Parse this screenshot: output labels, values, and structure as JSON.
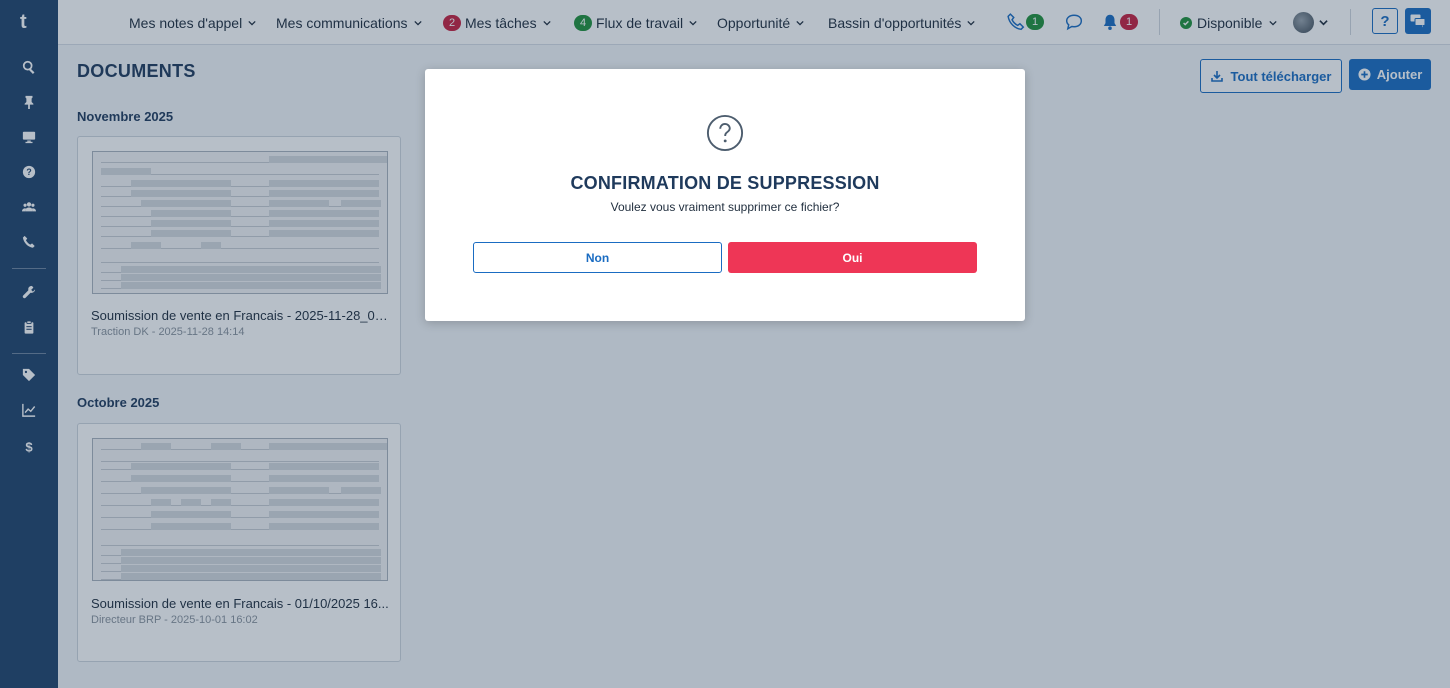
{
  "app": {
    "logo_text": "t"
  },
  "sidebar": {
    "items": [
      {
        "icon": "search-icon"
      },
      {
        "icon": "pin-icon"
      },
      {
        "icon": "monitor-icon"
      },
      {
        "icon": "help-circle-icon"
      },
      {
        "icon": "users-icon"
      },
      {
        "icon": "phone-icon"
      },
      {
        "icon": "wrench-icon"
      },
      {
        "icon": "clipboard-icon"
      },
      {
        "icon": "tag-icon"
      },
      {
        "icon": "chart-line-icon"
      },
      {
        "icon": "dollar-icon"
      }
    ]
  },
  "topbar": {
    "nav": [
      {
        "label": "Mes notes d'appel",
        "badge": null
      },
      {
        "label": "Mes communications",
        "badge": null
      },
      {
        "label": "Mes tâches",
        "badge": "2",
        "badge_color": "#c8203f"
      },
      {
        "label": "Flux de travail",
        "badge": "4",
        "badge_color": "#20913a"
      },
      {
        "label": "Opportunité",
        "badge": null
      },
      {
        "label": "Bassin d'opportunités",
        "badge": null
      }
    ],
    "phone_count": "1",
    "notification_count": "1",
    "status_label": "Disponible",
    "help_label": "?"
  },
  "main": {
    "title": "DOCUMENTS",
    "download_all_label": "Tout télécharger",
    "add_label": "Ajouter",
    "sections": [
      {
        "title": "Novembre 2025",
        "documents": [
          {
            "name": "Soumission de vente en Francais - 2025-11-28_02-...",
            "meta": "Traction DK - 2025-11-28 14:14"
          }
        ]
      },
      {
        "title": "Octobre 2025",
        "documents": [
          {
            "name": "Soumission de vente en Francais - 01/10/2025 16...",
            "meta": "Directeur BRP - 2025-10-01 16:02"
          }
        ]
      }
    ]
  },
  "modal": {
    "title": "CONFIRMATION DE SUPPRESSION",
    "message": "Voulez vous vraiment supprimer ce fichier?",
    "no_label": "Non",
    "yes_label": "Oui"
  },
  "colors": {
    "sidebar": "#20436b",
    "accent": "#1a6cc2",
    "danger": "#ee3656",
    "success": "#20913a"
  }
}
